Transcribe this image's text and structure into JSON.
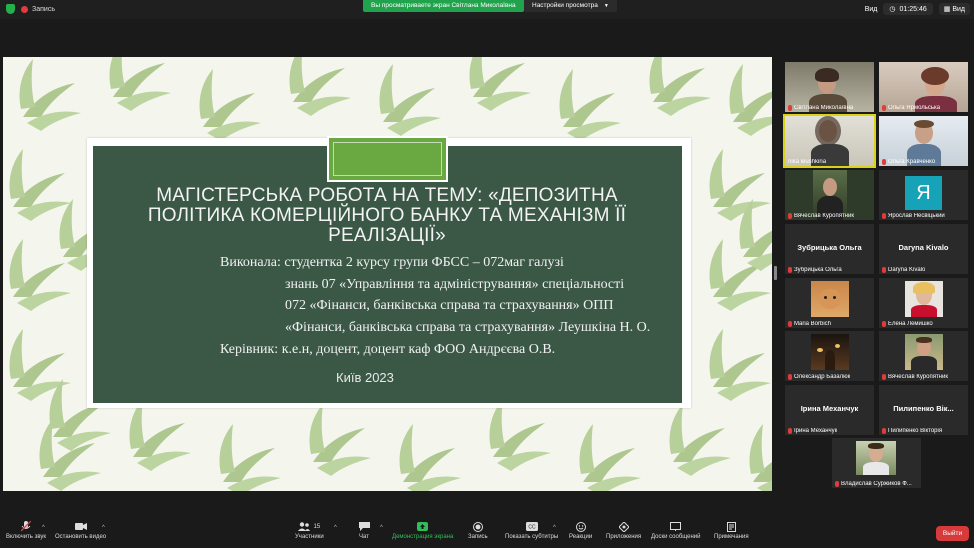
{
  "topbar": {
    "recording_label": "Запись",
    "share_banner": "Вы просматриваете экран Світлана Миколаївна",
    "view_settings": "Настройки просмотра",
    "view_label": "Вид",
    "timer": "01:25:46",
    "video_label": "Вид"
  },
  "slide": {
    "title": "МАГІСТЕРСЬКА РОБОТА НА ТЕМУ: «ДЕПОЗИТНА ПОЛІТИКА КОМЕРЦІЙНОГО БАНКУ ТА МЕХАНІЗМ ЇЇ РЕАЛІЗАЦІЇ»",
    "lines": [
      "Виконала: студентка 2 курсу групи ФБСС – 072маг галузі",
      "знань 07 «Управління та адміністрування» спеціальності",
      "072 «Фінанси, банківська справа та страхування» ОПП",
      "«Фінанси, банківська справа та страхування» Леушкіна Н. О.",
      "Керівник: к.е.н, доцент, доцент каф ФОО Андрєєва О.В."
    ],
    "city": "Київ 2023"
  },
  "participants": [
    {
      "name": "Світлана Миколаївна",
      "big": ""
    },
    {
      "name": "Ольга Ярмольська",
      "big": ""
    },
    {
      "name": "nika leushkina",
      "big": ""
    },
    {
      "name": "Ольга Кравченко",
      "big": ""
    },
    {
      "name": "Вячеслав Куропятник",
      "big": ""
    },
    {
      "name": "Ярослав Несвіцький",
      "big": ""
    },
    {
      "name": "Зубрицька Ольга",
      "big": "Зубрицька Ольга"
    },
    {
      "name": "Daryna Kivalo",
      "big": "Daryna Kivalo"
    },
    {
      "name": "Maria Borbich",
      "big": ""
    },
    {
      "name": "Елена Лемишко",
      "big": ""
    },
    {
      "name": "Олександр Базалюк",
      "big": ""
    },
    {
      "name": "Вячеслав Куропятник",
      "big": ""
    },
    {
      "name": "Ірина Механчук",
      "big": "Ірина Механчук"
    },
    {
      "name": "Пилипенко Вікторія",
      "big": "Пилипенко Вік..."
    },
    {
      "name": "Владислав Суржиков Ф...",
      "big": ""
    }
  ],
  "avatar_letter": "Я",
  "toolbar": {
    "mute": "Включить звук",
    "video": "Остановить видео",
    "participants": "Участники",
    "participants_count": "15",
    "chat": "Чат",
    "share": "Демонстрация экрана",
    "record": "Запись",
    "subtitles": "Показать субтитры",
    "reactions": "Реакции",
    "apps": "Приложения",
    "whiteboards": "Доски сообщений",
    "notes": "Примечания",
    "leave": "Выйти"
  },
  "colors": {
    "slide_bg": "#3b5847",
    "accent_green": "#6aa842",
    "share_green": "#20a34c",
    "leave_red": "#d63a3a",
    "active_outline": "#d8d21a"
  }
}
